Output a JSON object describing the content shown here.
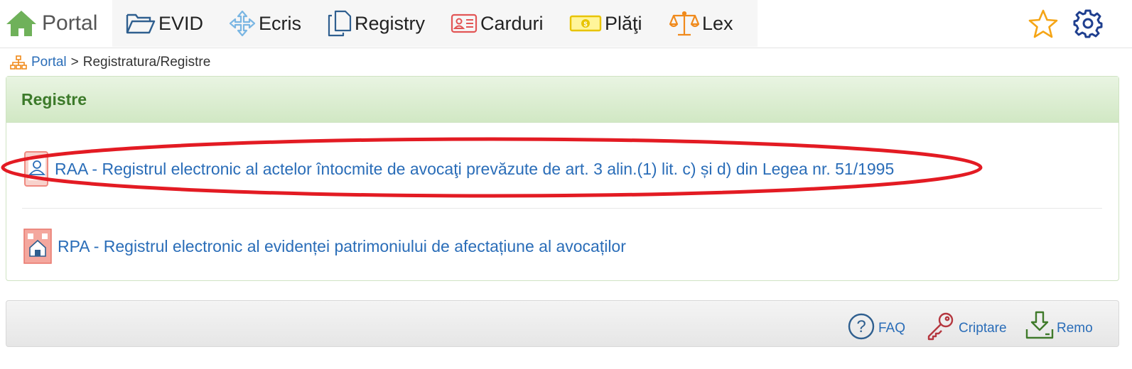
{
  "nav": {
    "portal": "Portal",
    "items": [
      {
        "label": "EVID",
        "icon": "folder-open-icon"
      },
      {
        "label": "Ecris",
        "icon": "move-arrows-icon"
      },
      {
        "label": "Registry",
        "icon": "copy-documents-icon"
      },
      {
        "label": "Carduri",
        "icon": "id-card-icon"
      },
      {
        "label": "Plăţi",
        "icon": "banknote-icon"
      },
      {
        "label": "Lex",
        "icon": "scales-icon"
      }
    ],
    "right_icons": [
      "star-icon",
      "gear-icon"
    ]
  },
  "breadcrumb": {
    "link": "Portal",
    "separator": ">",
    "current": "Registratura/Registre"
  },
  "panel": {
    "title": "Registre",
    "registers": [
      {
        "label": "RAA - Registrul electronic al actelor întocmite de avocaţi prevăzute de art. 3 alin.(1) lit. c) și d) din Legea nr. 51/1995",
        "icon": "user-document-icon",
        "highlighted": true
      },
      {
        "label": "RPA - Registrul electronic al evidenței patrimoniului de afectațiune al avocaților",
        "icon": "building-icon",
        "highlighted": false
      }
    ]
  },
  "footer": {
    "faq": "FAQ",
    "criptare": "Criptare",
    "remo": "Remo"
  },
  "colors": {
    "link": "#2a6db8",
    "panel_title": "#3c7a2a",
    "highlight": "#e31b23"
  }
}
